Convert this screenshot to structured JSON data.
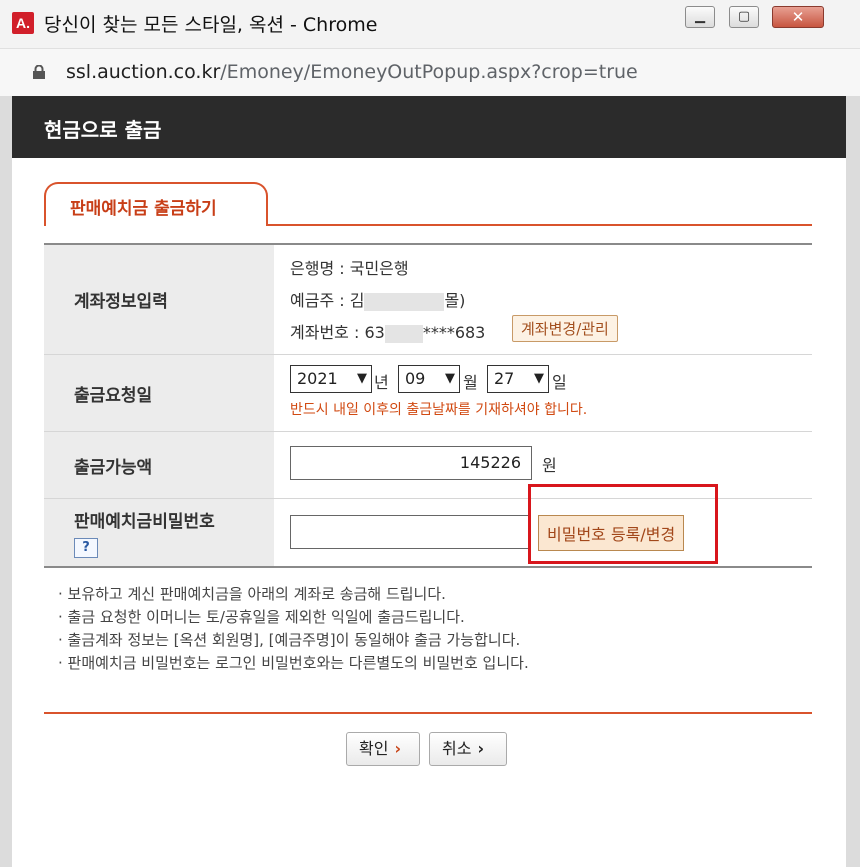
{
  "window": {
    "title": "당신이 찾는 모든 스타일, 옥션 - Chrome",
    "app_badge": "A.",
    "controls": {
      "minimize_icon": "minimize-icon",
      "maximize_icon": "maximize-icon",
      "close_icon": "close-icon"
    }
  },
  "address_bar": {
    "url_host": "ssl.auction.co.kr",
    "url_path": "/Emoney/EmoneyOutPopup.aspx?crop=true"
  },
  "header": {
    "title": "현금으로 출금"
  },
  "tab": {
    "label": "판매예치금 출금하기"
  },
  "form": {
    "account": {
      "label": "계좌정보입력",
      "bank_line": "은행명 : 국민은행",
      "holder_prefix": "예금주 : 김",
      "holder_suffix": "몰)",
      "number_prefix": "계좌번호 : 63",
      "number_suffix": "****683",
      "change_button": "계좌변경/관리"
    },
    "date": {
      "label": "출금요청일",
      "year": "2021",
      "year_unit": "년",
      "month": "09",
      "month_unit": "월",
      "day": "27",
      "day_unit": "일",
      "warning": "반드시 내일 이후의 출금날짜를 기재하셔야 합니다."
    },
    "amount": {
      "label": "출금가능액",
      "value": "145226",
      "unit": "원"
    },
    "password": {
      "label": "판매예치금비밀번호",
      "help_icon": "?",
      "register_button": "비밀번호 등록/변경"
    }
  },
  "notes": [
    "· 보유하고 계신 판매예치금을 아래의 계좌로 송금해 드립니다.",
    "· 출금 요청한 이머니는 토/공휴일을 제외한 익일에 출금드립니다.",
    "· 출금계좌 정보는 [옥션 회원명], [예금주명]이 동일해야 출금 가능합니다.",
    "· 판매예치금 비밀번호는 로그인 비밀번호와는 다른별도의 비밀번호 입니다."
  ],
  "buttons": {
    "confirm": "확인",
    "cancel": "취소",
    "arrow": "›"
  },
  "colors": {
    "accent": "#d9532c",
    "header_bg": "#2b2b2b",
    "highlight": "#d8161c",
    "warning": "#d14a12"
  }
}
